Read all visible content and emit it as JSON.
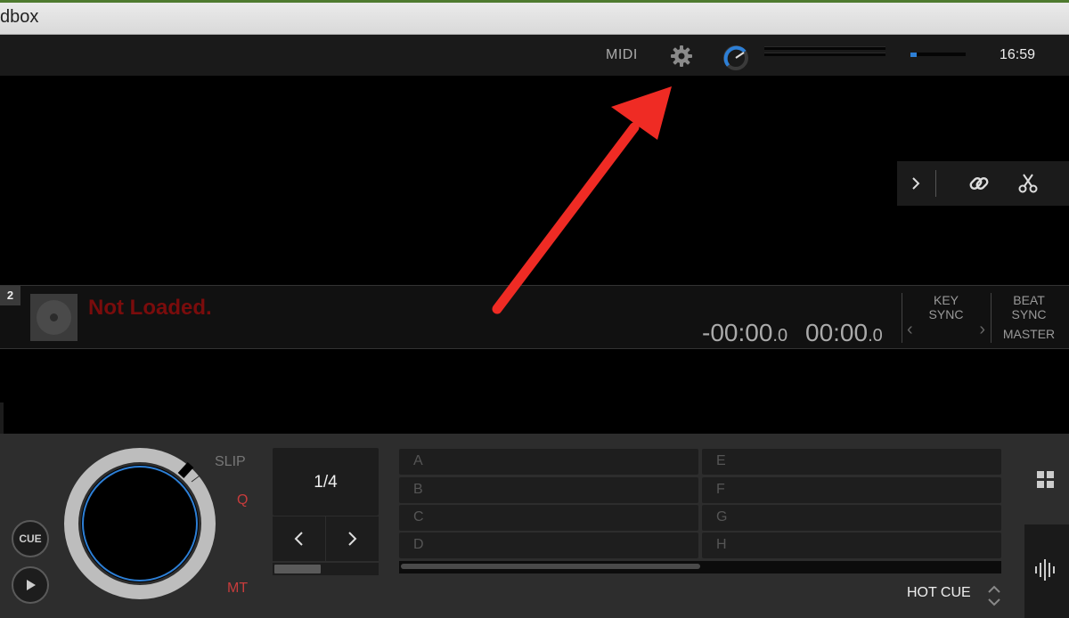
{
  "window": {
    "title": "dbox"
  },
  "topbar": {
    "midi_label": "MIDI",
    "clock": "16:59"
  },
  "deck": {
    "number": "2",
    "status": "Not Loaded.",
    "time_remaining_main": "-00:00",
    "time_remaining_frac": ".0",
    "time_elapsed_main": "00:00",
    "time_elapsed_frac": ".0",
    "key_label": "KEY",
    "sync_label": "SYNC",
    "beat_label": "BEAT",
    "beat_sync_label": "SYNC",
    "master_label": "MASTER"
  },
  "controls": {
    "cue_label": "CUE",
    "slip_label": "SLIP",
    "quantize_label": "Q",
    "mt_label": "MT",
    "loop_value": "1/4",
    "loop_position": 0.45
  },
  "hot_cues": {
    "pads": [
      "A",
      "B",
      "C",
      "D",
      "E",
      "F",
      "G",
      "H"
    ],
    "mode_label": "HOT CUE"
  },
  "colors": {
    "accent_blue": "#2d7fd6",
    "not_loaded_red": "#7a0c0c",
    "active_red": "#c83c3c",
    "annotation_arrow": "#ef2b24"
  }
}
